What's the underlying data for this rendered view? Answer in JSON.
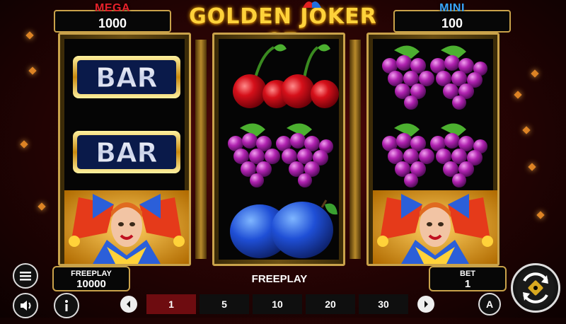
{
  "title": "GOLDEN JOKER 27",
  "jackpots": {
    "mega": {
      "label": "MEGA",
      "value": "1000"
    },
    "mini": {
      "label": "MINI",
      "value": "100"
    }
  },
  "reels": [
    {
      "symbols": [
        "BAR",
        "BAR",
        "joker"
      ]
    },
    {
      "symbols": [
        "cherries",
        "grapes",
        "plums"
      ]
    },
    {
      "symbols": [
        "grapes",
        "grapes",
        "joker"
      ]
    }
  ],
  "freeplay_box": {
    "label": "FREEPLAY",
    "value": "10000"
  },
  "status_text": "FREEPLAY",
  "bet_box": {
    "label": "BET",
    "value": "1"
  },
  "bet_options": [
    "1",
    "5",
    "10",
    "20",
    "30"
  ],
  "selected_bet": "1",
  "icons": {
    "menu": "hamburger-icon",
    "sound": "speaker-icon",
    "info": "info-icon",
    "autoplay": "autoplay-icon",
    "spin": "spin-icon",
    "prev": "chevron-left-icon",
    "next": "chevron-right-icon"
  },
  "colors": {
    "gold": "#c9a24a",
    "mega": "#e8212a",
    "mini": "#39a6ff",
    "selected_bet": "#6e0c10"
  }
}
